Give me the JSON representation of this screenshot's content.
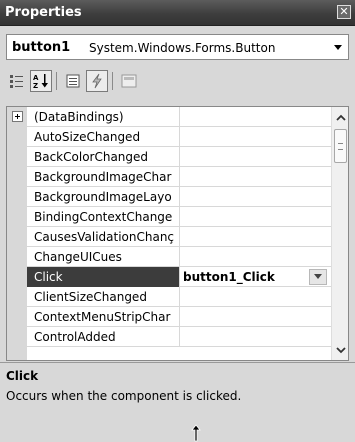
{
  "window": {
    "title": "Properties",
    "close_glyph": "✕"
  },
  "selector": {
    "name": "button1",
    "type": "System.Windows.Forms.Button"
  },
  "toolbar": {
    "buttons": [
      {
        "icon": "categorized-icon",
        "pressed": false
      },
      {
        "icon": "alphabetical-icon",
        "pressed": true
      },
      {
        "icon": "properties-icon",
        "pressed": false
      },
      {
        "icon": "events-icon",
        "pressed": true
      },
      {
        "icon": "property-pages-icon",
        "pressed": false
      }
    ]
  },
  "grid": {
    "rows": [
      {
        "name": "(DataBindings)",
        "value": "",
        "expandable": true
      },
      {
        "name": "AutoSizeChanged",
        "value": ""
      },
      {
        "name": "BackColorChanged",
        "value": ""
      },
      {
        "name": "BackgroundImageChar",
        "value": ""
      },
      {
        "name": "BackgroundImageLayo",
        "value": ""
      },
      {
        "name": "BindingContextChange",
        "value": ""
      },
      {
        "name": "CausesValidationChanç",
        "value": ""
      },
      {
        "name": "ChangeUICues",
        "value": ""
      },
      {
        "name": "Click",
        "value": "button1_Click",
        "selected": true
      },
      {
        "name": "ClientSizeChanged",
        "value": ""
      },
      {
        "name": "ContextMenuStripChar",
        "value": ""
      },
      {
        "name": "ControlAdded",
        "value": ""
      }
    ]
  },
  "description": {
    "title": "Click",
    "text": "Occurs when the component is clicked."
  },
  "colors": {
    "titlebar": "#3e3e3e",
    "selection": "#3c3c3c",
    "panel": "#d8d8d8"
  }
}
